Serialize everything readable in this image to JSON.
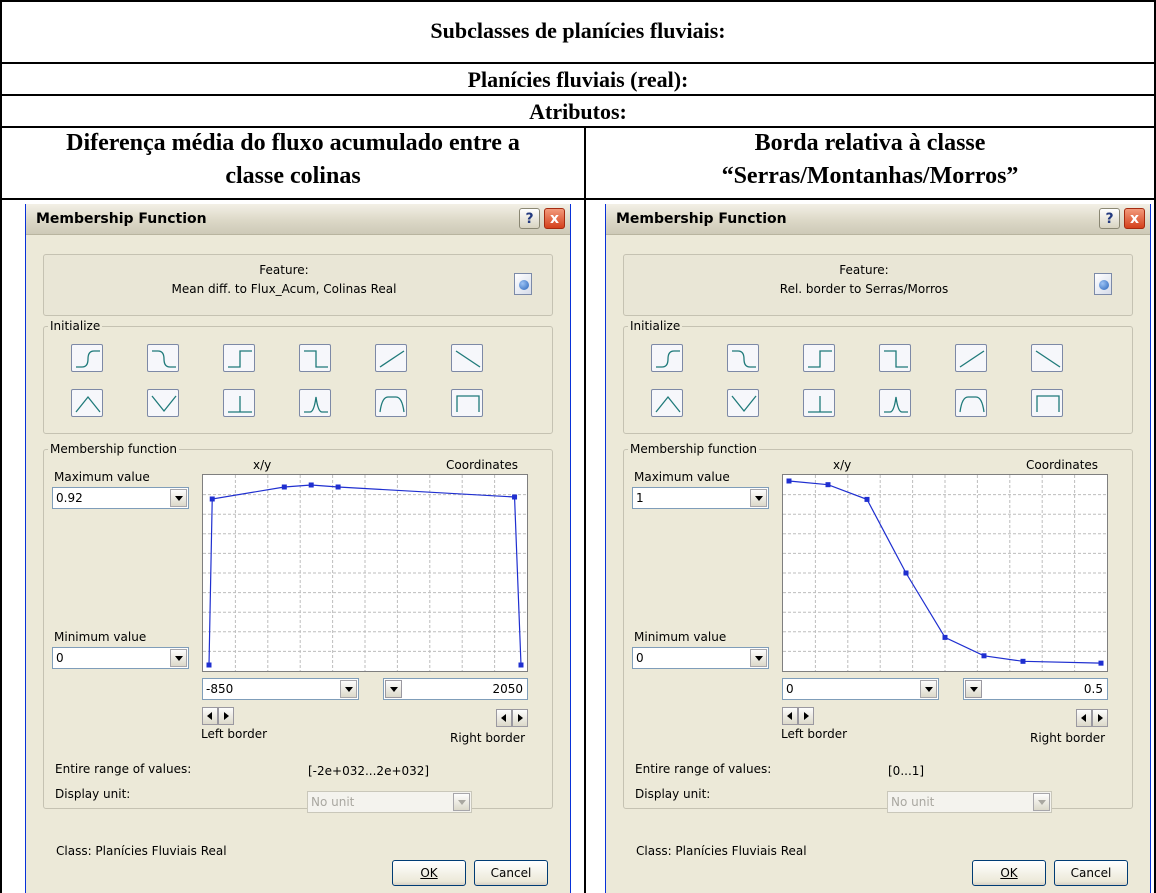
{
  "document": {
    "header": "Subclasses de planícies fluviais:",
    "subheader": "Planícies fluviais (real):",
    "attributes_label": "Atributos:",
    "col_left_line1": "Diferença média do fluxo acumulado entre a",
    "col_left_line2": "classe colinas",
    "col_right_line1": "Borda relativa à classe",
    "col_right_line2": "“Serras/Montanhas/Morros”"
  },
  "dialogs": [
    {
      "title": "Membership Function",
      "help_icon": "?",
      "close_icon": "x",
      "feature_label": "Feature:",
      "feature_name": "Mean diff. to Flux_Acum, Colinas Real",
      "initialize_label": "Initialize",
      "shapes": [
        "larger-s-icon",
        "smaller-s-icon",
        "larger-step-icon",
        "smaller-step-icon",
        "linear-up-icon",
        "linear-down-icon",
        "triangle-icon",
        "inverted-triangle-icon",
        "singleton-icon",
        "approx-gaussian-icon",
        "about-range-icon",
        "full-range-icon"
      ],
      "membership_label": "Membership function",
      "xy_label": "x/y",
      "coordinates_label": "Coordinates",
      "max_label": "Maximum value",
      "max_value": "0.92",
      "min_label": "Minimum value",
      "min_value": "0",
      "left_border_value": "-850",
      "right_border_value": "2050",
      "left_border_label": "Left border",
      "right_border_label": "Right border",
      "range_label": "Entire range of values:",
      "range_value": "[-2e+032...2e+032]",
      "unit_label": "Display unit:",
      "unit_value": "No unit",
      "class_label": "Class: Planícies Fluviais Real",
      "ok_label": "OK",
      "cancel_label": "Cancel",
      "curve": {
        "x_range": [
          -850,
          2050
        ],
        "y_range": [
          0,
          0.92
        ],
        "points": [
          [
            -850,
            0
          ],
          [
            -820,
            0.83
          ],
          [
            -150,
            0.89
          ],
          [
            100,
            0.9
          ],
          [
            350,
            0.89
          ],
          [
            1990,
            0.84
          ],
          [
            2050,
            0
          ]
        ]
      }
    },
    {
      "title": "Membership Function",
      "help_icon": "?",
      "close_icon": "x",
      "feature_label": "Feature:",
      "feature_name": "Rel. border to Serras/Morros",
      "initialize_label": "Initialize",
      "shapes": [
        "larger-s-icon",
        "smaller-s-icon",
        "larger-step-icon",
        "smaller-step-icon",
        "linear-up-icon",
        "linear-down-icon",
        "triangle-icon",
        "inverted-triangle-icon",
        "singleton-icon",
        "approx-gaussian-icon",
        "about-range-icon",
        "full-range-icon"
      ],
      "membership_label": "Membership function",
      "xy_label": "x/y",
      "coordinates_label": "Coordinates",
      "max_label": "Maximum value",
      "max_value": "1",
      "min_label": "Minimum value",
      "min_value": "0",
      "left_border_value": "0",
      "right_border_value": "0.5",
      "left_border_label": "Left border",
      "right_border_label": "Right border",
      "range_label": "Entire range of values:",
      "range_value": "[0...1]",
      "unit_label": "Display unit:",
      "unit_value": "No unit",
      "class_label": "Class: Planícies Fluviais Real",
      "ok_label": "OK",
      "cancel_label": "Cancel",
      "curve": {
        "x_range": [
          0,
          0.5
        ],
        "y_range": [
          0,
          1
        ],
        "points": [
          [
            0,
            1
          ],
          [
            0.0625,
            0.98
          ],
          [
            0.125,
            0.9
          ],
          [
            0.1875,
            0.5
          ],
          [
            0.25,
            0.15
          ],
          [
            0.3125,
            0.05
          ],
          [
            0.375,
            0.02
          ],
          [
            0.5,
            0.01
          ]
        ]
      }
    }
  ]
}
